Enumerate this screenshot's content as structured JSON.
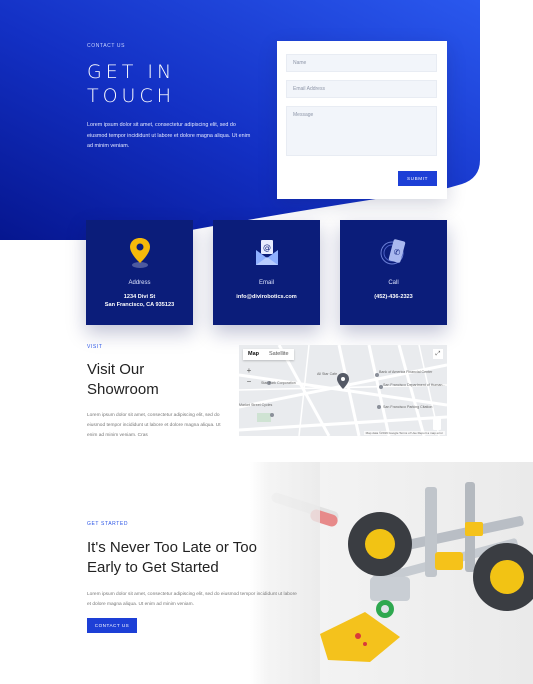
{
  "contact": {
    "eyebrow": "CONTACT US",
    "title_line1": "GET IN",
    "title_line2": "TOUCH",
    "text": "Lorem ipsum dolor sit amet, consectetur adipiscing elit, sed do eiusmod tempor incididunt ut labore et dolore magna aliqua. Ut enim ad minim veniam."
  },
  "form": {
    "name_placeholder": "Name",
    "email_placeholder": "Email Address",
    "message_placeholder": "Message",
    "submit_label": "SUBMIT"
  },
  "cards": [
    {
      "label": "Address",
      "value_line1": "1234 Divi St",
      "value_line2": "San Francisco, CA 935123",
      "icon": "location-pin-icon"
    },
    {
      "label": "Email",
      "value_line1": "info@divirobotics.com",
      "value_line2": "",
      "icon": "envelope-icon"
    },
    {
      "label": "Call",
      "value_line1": "(452)-436-2323",
      "value_line2": "",
      "icon": "phone-icon"
    }
  ],
  "visit": {
    "eyebrow": "VISIT",
    "title_line1": "Visit Our",
    "title_line2": "Showroom",
    "text": "Lorem ipsum dolor sit amet, consectetur adipiscing elit, sed do eiusmod tempor incididunt ut labore et dolore magna aliqua. Ut enim ad minim veniam. Cras"
  },
  "map": {
    "tab_map": "Map",
    "tab_satellite": "Satellite",
    "zoom_in": "+",
    "zoom_out": "−",
    "fullscreen": "⤢",
    "attribution": "Map data ©2019 Google   Terms of Use   Report a map error",
    "labels": [
      "Bank of America Financial Center",
      "San Francisco Department of Human...",
      "San Francisco Parking Citation",
      "Star Park Corporation",
      "Market Street Cycles",
      "All Star Cafe"
    ]
  },
  "started": {
    "eyebrow": "GET STARTED",
    "title_line1": "It's Never Too Late or Too",
    "title_line2": "Early to Get Started",
    "text": "Lorem ipsum dolor sit amet, consectetur adipiscing elit, sed do eiusmod tempor incididunt ut labore et dolore magna aliqua. Ut enim ad minim veniam.",
    "button_label": "CONTACT US"
  },
  "colors": {
    "hero_blue_light": "#1f45d9",
    "hero_blue_dark": "#06168f",
    "card_navy": "#0b1d7a",
    "accent": "#1d3fd6",
    "pin_yellow": "#f5b90a"
  }
}
